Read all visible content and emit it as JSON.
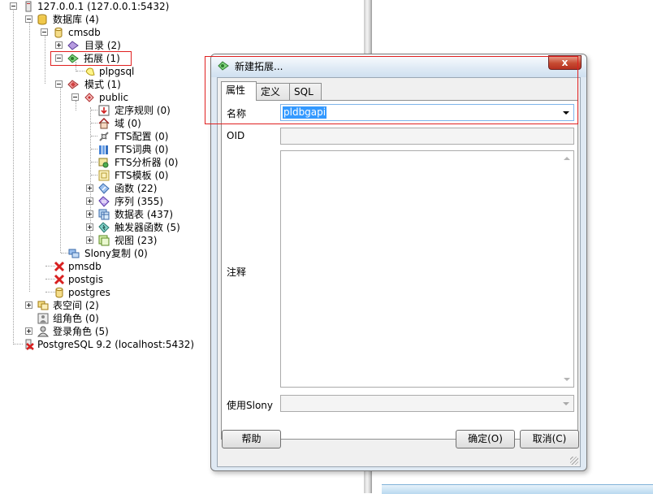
{
  "tree": {
    "server1": "127.0.0.1 (127.0.0.1:5432)",
    "databases": "数据库 (4)",
    "cmsdb": "cmsdb",
    "catalogs": "目录 (2)",
    "extensions": "拓展 (1)",
    "plpgsql": "plpgsql",
    "schemas": "模式 (1)",
    "public": "public",
    "collations": "定序规则 (0)",
    "domains": "域 (0)",
    "fts_config": "FTS配置 (0)",
    "fts_dict": "FTS词典 (0)",
    "fts_parser": "FTS分析器 (0)",
    "fts_template": "FTS模板 (0)",
    "functions": "函数 (22)",
    "sequences": "序列 (355)",
    "tables": "数据表 (437)",
    "trigger_functions": "触发器函数 (5)",
    "views": "视图 (23)",
    "slony": "Slony复制 (0)",
    "pmsdb": "pmsdb",
    "postgis": "postgis",
    "postgres": "postgres",
    "tablespaces": "表空间 (2)",
    "group_roles": "组角色 (0)",
    "login_roles": "登录角色 (5)",
    "server2": "PostgreSQL 9.2 (localhost:5432)"
  },
  "dialog": {
    "title": "新建拓展...",
    "close": "x",
    "tabs": [
      "属性",
      "定义",
      "SQL"
    ],
    "name_label": "名称",
    "name_value": "pldbgapi",
    "oid_label": "OID",
    "comment_label": "注释",
    "slony_label": "使用Slony",
    "help_button": "帮助",
    "ok_button": "确定(O)",
    "cancel_button": "取消(C)"
  },
  "colors": {
    "highlight": "#e02020",
    "selection": "#3399ff"
  }
}
